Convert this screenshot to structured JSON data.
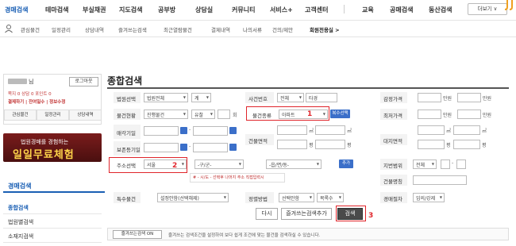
{
  "nav_main": {
    "items": [
      "경매검색",
      "테마검색",
      "부실채권",
      "지도검색",
      "공부방",
      "상담실",
      "커뮤니티",
      "서비스+",
      "고객센터",
      "교육",
      "공매검색",
      "동산검색"
    ],
    "more_label": "더보기 ∨"
  },
  "nav_sub": {
    "items": [
      "관심물건",
      "일정관리",
      "상담내역",
      "즐겨쓰는검색",
      "최근열람물건",
      "결제내역",
      "나의서류",
      "건의/제안",
      "회원전용실 >"
    ]
  },
  "user": {
    "name": "님",
    "logout": "로그아웃",
    "points": "쪽지 0  상담 0  포인트 0",
    "pay": "결제하기 | 잔여일수 | 정보수정",
    "tabs": [
      "관심물건",
      "일정관리",
      "상담내역"
    ]
  },
  "banner": {
    "line1": "법원경매를 경험하는",
    "line2": "일일무료체험"
  },
  "sidebar": {
    "title": "경매검색",
    "items": [
      "종합검색",
      "법원별검색",
      "소재지검색"
    ]
  },
  "page_title": "종합검색",
  "form": {
    "court_label": "법원선택",
    "court_value": "법원전체",
    "court_gye": "계",
    "case_label": "사건번호",
    "case_select": "전체",
    "case_placeholder": "타경",
    "appraisal_label": "감정가격",
    "won": "만원",
    "status_label": "물건현황",
    "status_value": "진행물건",
    "fail_select": "유찰",
    "fail_unit": "회",
    "type_label": "물건종류",
    "type_value": "아파트",
    "multi_btn": "복수선택",
    "min_label": "최저가격",
    "sale_date_label": "매각기일",
    "building_area_label": "건물면적",
    "land_area_label": "대지면적",
    "m2": "㎡",
    "pyeong": "평",
    "reg_date_label": "보존등기일",
    "address_label": "주소선택",
    "address_value": "서울",
    "gu_value": "-구/군-",
    "dong_value": "-읍/면/동-",
    "add_btn": "추가",
    "jibun_label": "지번범위",
    "jibun_value": "전체",
    "address_hint": "# - 시/도 - 선택후 나머지 주소 직접입력시",
    "building_name_label": "건물명칭",
    "special_label": "특수물건",
    "special_value": "설정안함(선택해제)",
    "sort_label": "정렬방법",
    "sort_value": "선택안함",
    "sort_order": "목록수",
    "proc_label": "경매절차",
    "proc_value": "임의/강제",
    "reset_btn": "다시",
    "fav_add_btn": "즐겨쓰는검색추가",
    "search_btn": "검색"
  },
  "markers": [
    "1",
    "2",
    "3"
  ],
  "tip": {
    "btn": "즐겨쓰는검색 ON",
    "text": "즐겨쓰는 검색조건을 설정하여 보다 쉽게 조건에 맞는 물건을 검색하실 수 있습니다."
  },
  "colors": {
    "accent": "#1a5fb4",
    "highlight": "#e0252b",
    "search_btn": "#4a4a4a"
  }
}
